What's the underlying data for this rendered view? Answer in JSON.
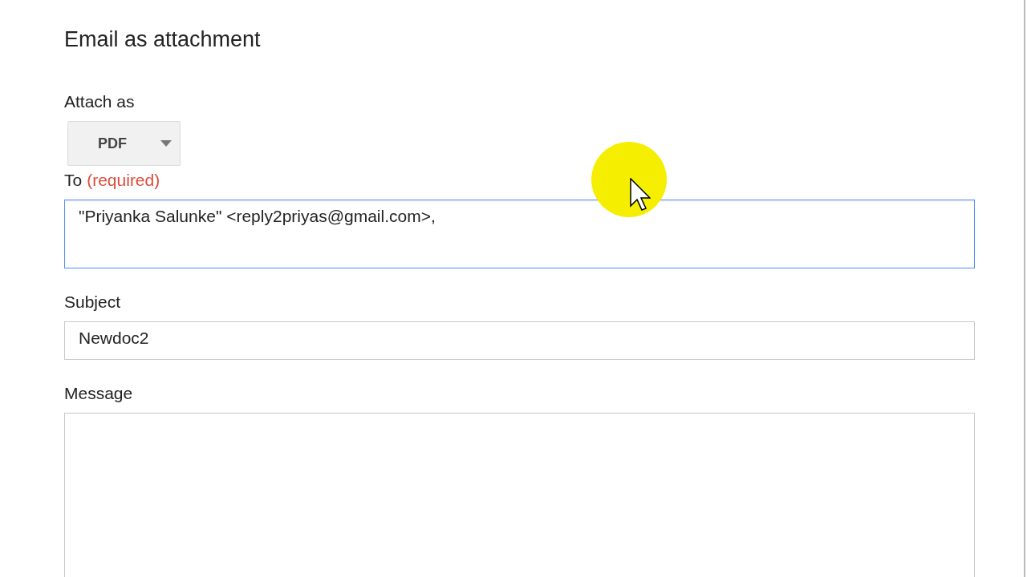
{
  "dialog": {
    "title": "Email as attachment"
  },
  "attach_as": {
    "label": "Attach as",
    "value": "PDF"
  },
  "to": {
    "label": "To",
    "note": "(required)",
    "value": "\"Priyanka Salunke\" <reply2priyas@gmail.com>,",
    "focused": true
  },
  "subject": {
    "label": "Subject",
    "value": "Newdoc2",
    "focused": false
  },
  "message": {
    "label": "Message",
    "focused": false
  }
}
